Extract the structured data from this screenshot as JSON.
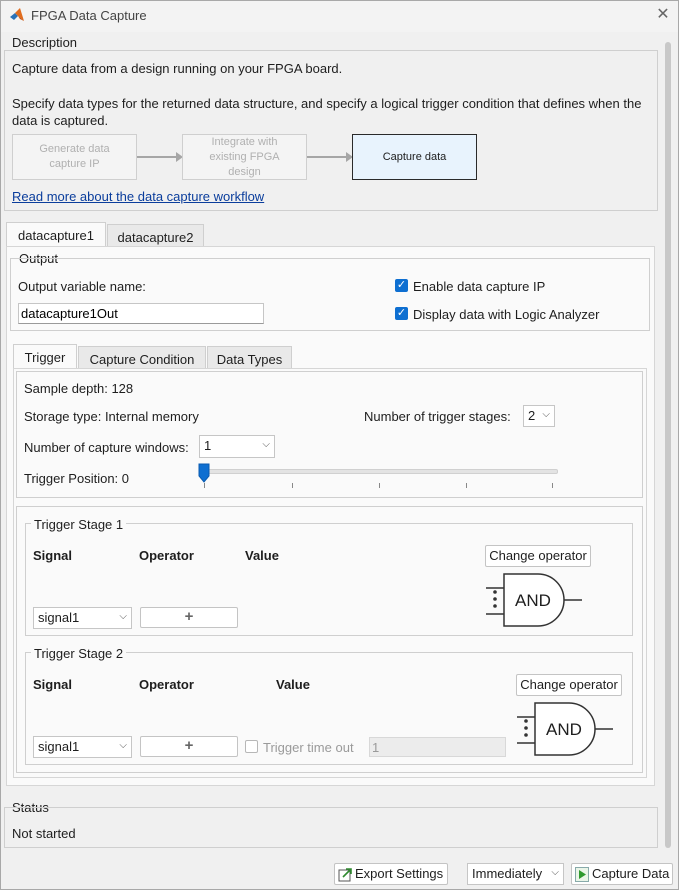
{
  "window": {
    "title": "FPGA Data Capture"
  },
  "description": {
    "header": "Description",
    "line1": "Capture data from a design running on your FPGA board.",
    "line2": "Specify data types for the returned data structure, and specify a logical trigger condition that defines when the data is captured.",
    "workflow": [
      {
        "label": "Generate data capture IP",
        "state": "dim"
      },
      {
        "label": "Integrate with existing FPGA design",
        "state": "dim"
      },
      {
        "label": "Capture data",
        "state": "active"
      }
    ],
    "link": "Read more about the data capture workflow"
  },
  "tabs": [
    {
      "label": "datacapture1",
      "active": true
    },
    {
      "label": "datacapture2",
      "active": false
    }
  ],
  "output": {
    "header": "Output",
    "var_label": "Output variable name:",
    "var_value": "datacapture1Out",
    "enable_ip_label": "Enable data capture IP",
    "enable_ip_checked": true,
    "logic_analyzer_label": "Display data with Logic Analyzer",
    "logic_analyzer_checked": true
  },
  "subtabs": [
    {
      "label": "Trigger",
      "active": true
    },
    {
      "label": "Capture Condition",
      "active": false
    },
    {
      "label": "Data Types",
      "active": false
    }
  ],
  "trigger": {
    "sample_depth": "Sample depth: 128",
    "storage_type": "Storage type: Internal memory",
    "stages_label": "Number of trigger stages:",
    "stages_value": "2",
    "windows_label": "Number of capture windows:",
    "windows_value": "1",
    "position_label": "Trigger Position: 0",
    "position_fraction": 0
  },
  "stage1": {
    "header": "Trigger Stage 1",
    "col_signal": "Signal",
    "col_operator": "Operator",
    "col_value": "Value",
    "change_operator": "Change operator",
    "gate": "AND",
    "signal_value": "signal1",
    "operator_symbol": "+"
  },
  "stage2": {
    "header": "Trigger Stage 2",
    "col_signal": "Signal",
    "col_operator": "Operator",
    "col_value": "Value",
    "change_operator": "Change operator",
    "gate": "AND",
    "signal_value": "signal1",
    "operator_symbol": "+",
    "timeout_label": "Trigger time out",
    "timeout_checked": false,
    "timeout_value": "1"
  },
  "status": {
    "header": "Status",
    "text": "Not started"
  },
  "footer": {
    "export": "Export Settings",
    "mode": "Immediately",
    "capture": "Capture Data"
  },
  "colors": {
    "accent": "#0e6fd1",
    "link": "#0a3d9c",
    "active_step_bg": "#e8f3fd"
  }
}
